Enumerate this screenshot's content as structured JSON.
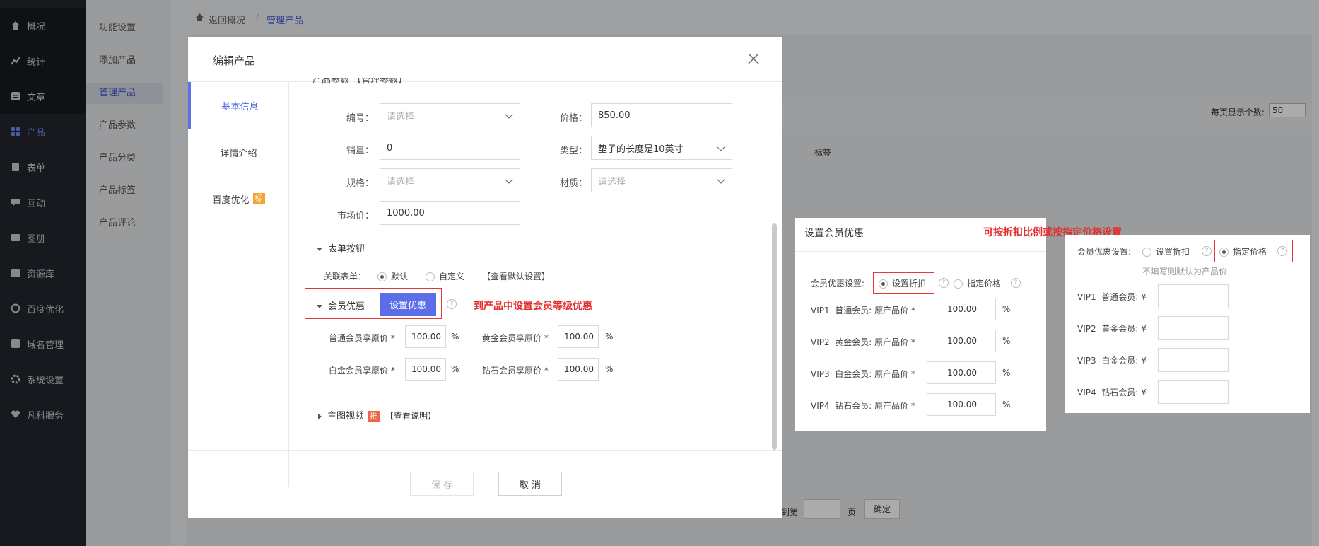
{
  "sidebar": {
    "items": [
      {
        "label": "概况",
        "icon": "home-icon"
      },
      {
        "label": "统计",
        "icon": "chart-icon"
      },
      {
        "label": "文章",
        "icon": "article-icon"
      },
      {
        "label": "产品",
        "icon": "product-icon"
      },
      {
        "label": "表单",
        "icon": "form-icon"
      },
      {
        "label": "互动",
        "icon": "chat-icon"
      },
      {
        "label": "图册",
        "icon": "album-icon"
      },
      {
        "label": "资源库",
        "icon": "database-icon"
      },
      {
        "label": "百度优化",
        "icon": "seo-icon"
      },
      {
        "label": "域名管理",
        "icon": "domain-icon"
      },
      {
        "label": "系统设置",
        "icon": "gear-icon"
      },
      {
        "label": "凡科服务",
        "icon": "heart-icon"
      }
    ],
    "active_index": 3
  },
  "subnav": {
    "items": [
      "功能设置",
      "添加产品",
      "管理产品",
      "产品参数",
      "产品分类",
      "产品标签",
      "产品评论"
    ],
    "active_index": 2
  },
  "breadcrumb": {
    "back": "返回概况",
    "sep": "/",
    "current": "管理产品"
  },
  "background": {
    "per_page_label": "每页显示个数:",
    "per_page_value": "50",
    "col_tag": "标签",
    "goto_label": "到第",
    "page_unit": "页",
    "confirm": "确定"
  },
  "modal": {
    "title": "编辑产品",
    "tabs": [
      {
        "label": "基本信息",
        "badge": ""
      },
      {
        "label": "详情介绍",
        "badge": ""
      },
      {
        "label": "百度优化",
        "badge": "标"
      }
    ],
    "cut_section": "产品参数 【管理参数】",
    "fields": {
      "code_label": "编号：",
      "code_placeholder": "请选择",
      "price_label": "价格：",
      "price_value": "850.00",
      "sales_label": "销量：",
      "sales_value": "0",
      "type_label": "类型：",
      "type_value": "垫子的长度是10英寸",
      "spec_label": "规格：",
      "spec_placeholder": "请选择",
      "material_label": "材质：",
      "material_placeholder": "请选择",
      "market_label": "市场价：",
      "market_value": "1000.00"
    },
    "form_section": {
      "title": "表单按钮",
      "assoc_label": "关联表单：",
      "opt_default": "默认",
      "opt_custom": "自定义",
      "view_default": "【查看默认设置】"
    },
    "member_section": {
      "title": "会员优惠",
      "button": "设置优惠",
      "annotation": "到产品中设置会员等级优惠",
      "rows": [
        {
          "label": "普通会员享原价 *",
          "value": "100.00",
          "unit": "%"
        },
        {
          "label": "黄金会员享原价 *",
          "value": "100.00",
          "unit": "%"
        },
        {
          "label": "白金会员享原价 *",
          "value": "100.00",
          "unit": "%"
        },
        {
          "label": "钻石会员享原价 *",
          "value": "100.00",
          "unit": "%"
        }
      ]
    },
    "video_section": {
      "title": "主图视频",
      "badge": "推",
      "link": "【查看说明】"
    },
    "save": "保 存",
    "cancel": "取 消"
  },
  "discount_card": {
    "title": "设置会员优惠",
    "setting_label": "会员优惠设置:",
    "opt_discount": "设置折扣",
    "opt_price": "指定价格",
    "rows": [
      {
        "label": "VIP1  普通会员: 原产品价 *",
        "value": "100.00",
        "unit": "%"
      },
      {
        "label": "VIP2  黄金会员: 原产品价 *",
        "value": "100.00",
        "unit": "%"
      },
      {
        "label": "VIP3  白金会员: 原产品价 *",
        "value": "100.00",
        "unit": "%"
      },
      {
        "label": "VIP4  钻石会员: 原产品价 *",
        "value": "100.00",
        "unit": "%"
      }
    ]
  },
  "annotation_right": "可按折扣比例或按指定价格设置",
  "price_card": {
    "setting_label": "会员优惠设置:",
    "opt_discount": "设置折扣",
    "opt_price": "指定价格",
    "hint": "不填写则默认为产品价",
    "rows": [
      {
        "label": "VIP1  普通会员: ¥",
        "value": ""
      },
      {
        "label": "VIP2  黄金会员: ¥",
        "value": ""
      },
      {
        "label": "VIP3  白金会员: ¥",
        "value": ""
      },
      {
        "label": "VIP4  钻石会员: ¥",
        "value": ""
      }
    ]
  }
}
